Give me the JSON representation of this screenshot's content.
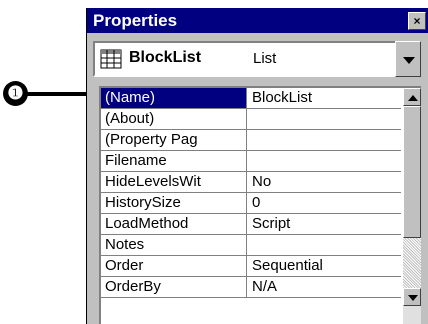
{
  "callout": {
    "number": "❶"
  },
  "window": {
    "title": "Properties",
    "close_label": "×"
  },
  "object_selector": {
    "name": "BlockList",
    "type": "List",
    "icon": "list-grid-icon"
  },
  "properties": [
    {
      "name": "(Name)",
      "value": "BlockList",
      "selected": true
    },
    {
      "name": "(About)",
      "value": ""
    },
    {
      "name": "(Property Pag",
      "value": ""
    },
    {
      "name": "Filename",
      "value": ""
    },
    {
      "name": "HideLevelsWit",
      "value": "No"
    },
    {
      "name": "HistorySize",
      "value": "0"
    },
    {
      "name": "LoadMethod",
      "value": "Script"
    },
    {
      "name": "Notes",
      "value": ""
    },
    {
      "name": "Order",
      "value": "Sequential"
    },
    {
      "name": "OrderBy",
      "value": "N/A"
    }
  ],
  "colors": {
    "titlebar": "#000080",
    "selection": "#000080",
    "chrome": "#c0c0c0"
  }
}
